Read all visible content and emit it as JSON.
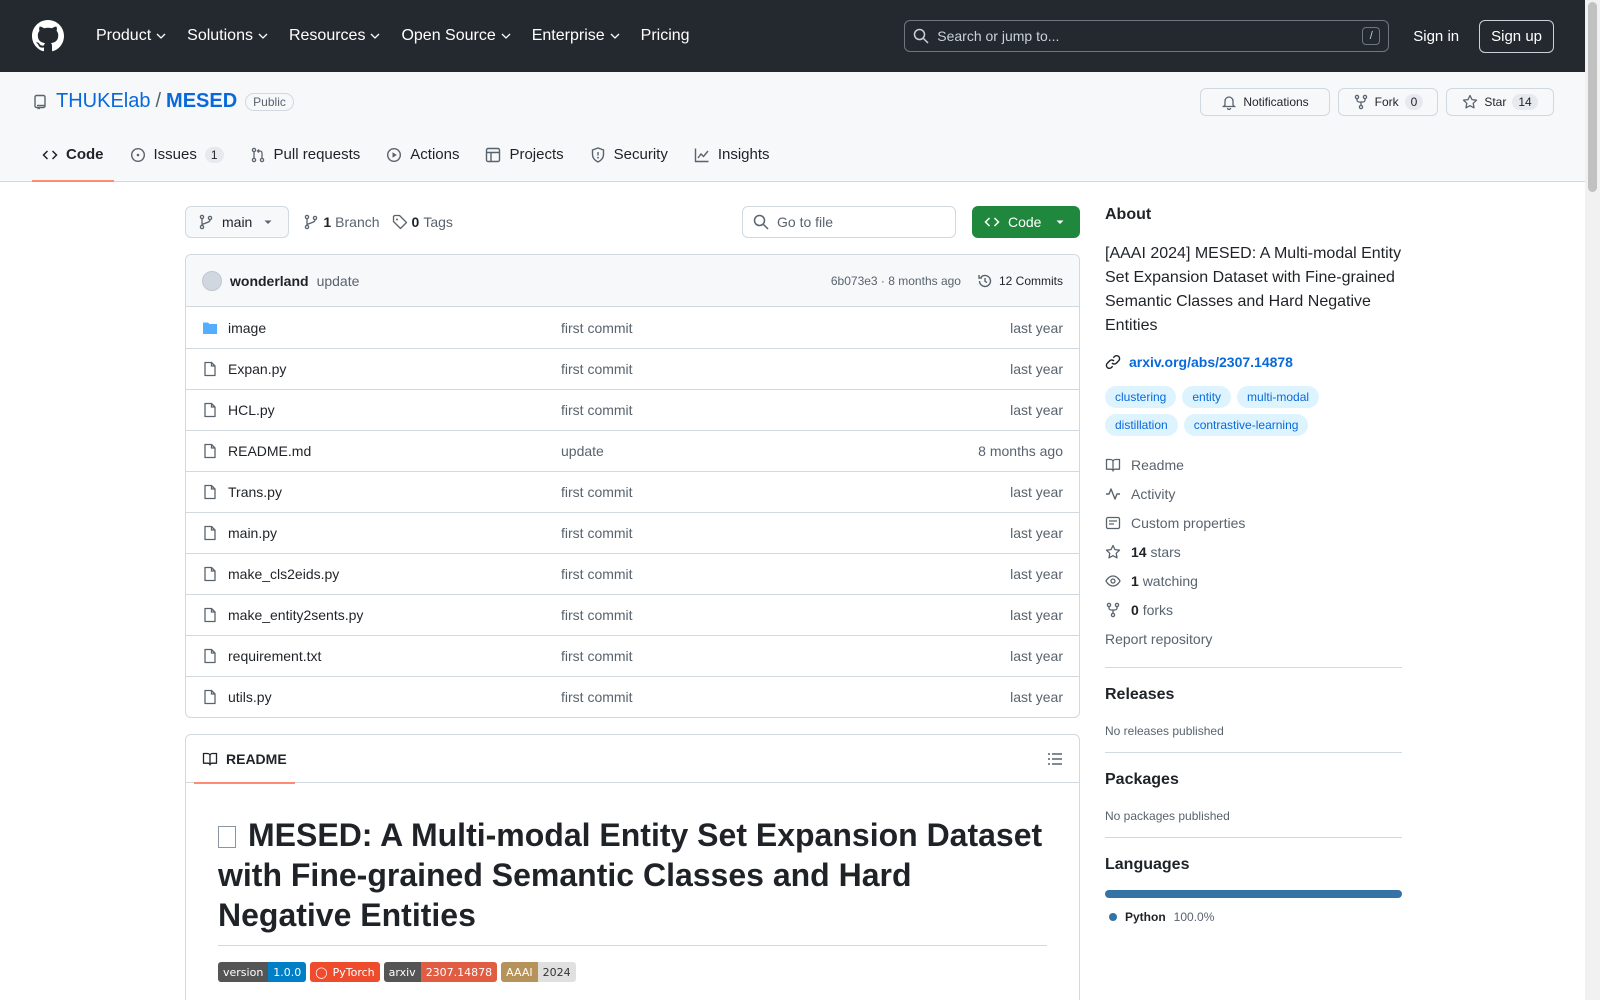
{
  "header": {
    "nav": [
      "Product",
      "Solutions",
      "Resources",
      "Open Source",
      "Enterprise",
      "Pricing"
    ],
    "search_placeholder": "Search or jump to...",
    "search_shortcut": "/",
    "signin": "Sign in",
    "signup": "Sign up"
  },
  "repo": {
    "owner": "THUKElab",
    "separator": "/",
    "name": "MESED",
    "visibility": "Public",
    "notifications_label": "Notifications",
    "fork_label": "Fork",
    "fork_count": "0",
    "star_label": "Star",
    "star_count": "14"
  },
  "tabs": [
    {
      "label": "Code",
      "count": ""
    },
    {
      "label": "Issues",
      "count": "1"
    },
    {
      "label": "Pull requests",
      "count": ""
    },
    {
      "label": "Actions",
      "count": ""
    },
    {
      "label": "Projects",
      "count": ""
    },
    {
      "label": "Security",
      "count": ""
    },
    {
      "label": "Insights",
      "count": ""
    }
  ],
  "toolbar": {
    "branch": "main",
    "branch_count": "1",
    "branch_label": "Branch",
    "tag_count": "0",
    "tag_label": "Tags",
    "goto_placeholder": "Go to file",
    "code_label": "Code"
  },
  "commit": {
    "author": "wonderland",
    "message": "update",
    "meta": "6b073e3 · 8 months ago",
    "commits_label": "12 Commits"
  },
  "files": [
    {
      "name": "image",
      "commit": "first commit",
      "date": "last year",
      "type": "dir"
    },
    {
      "name": "Expan.py",
      "commit": "first commit",
      "date": "last year",
      "type": "file"
    },
    {
      "name": "HCL.py",
      "commit": "first commit",
      "date": "last year",
      "type": "file"
    },
    {
      "name": "README.md",
      "commit": "update",
      "date": "8 months ago",
      "type": "file"
    },
    {
      "name": "Trans.py",
      "commit": "first commit",
      "date": "last year",
      "type": "file"
    },
    {
      "name": "main.py",
      "commit": "first commit",
      "date": "last year",
      "type": "file"
    },
    {
      "name": "make_cls2eids.py",
      "commit": "first commit",
      "date": "last year",
      "type": "file"
    },
    {
      "name": "make_entity2sents.py",
      "commit": "first commit",
      "date": "last year",
      "type": "file"
    },
    {
      "name": "requirement.txt",
      "commit": "first commit",
      "date": "last year",
      "type": "file"
    },
    {
      "name": "utils.py",
      "commit": "first commit",
      "date": "last year",
      "type": "file"
    }
  ],
  "readme": {
    "tab_label": "README",
    "title": "MESED: A Multi-modal Entity Set Expansion Dataset with Fine-grained Semantic Classes and Hard Negative Entities",
    "shields": [
      {
        "left": "version",
        "right": "1.0.0",
        "left_color": "#555555",
        "right_color": "#007ec6"
      },
      {
        "left": "",
        "right": "PyTorch",
        "left_color": "#ee4c2c",
        "right_color": "#ee4c2c"
      },
      {
        "left": "arxiv",
        "right": "2307.14878",
        "left_color": "#555555",
        "right_color": "#e05d44"
      },
      {
        "left": "AAAI",
        "right": "2024",
        "left_color": "#b5935a",
        "right_color": "#e0e0e0"
      }
    ]
  },
  "about": {
    "heading": "About",
    "description": "[AAAI 2024] MESED: A Multi-modal Entity Set Expansion Dataset with Fine-grained Semantic Classes and Hard Negative Entities",
    "link": "arxiv.org/abs/2307.14878",
    "topics": [
      "clustering",
      "entity",
      "multi-modal",
      "distillation",
      "contrastive-learning"
    ],
    "readme": "Readme",
    "activity": "Activity",
    "custom_properties": "Custom properties",
    "stars_count": "14",
    "stars_label": "stars",
    "watching_count": "1",
    "watching_label": "watching",
    "forks_count": "0",
    "forks_label": "forks",
    "report": "Report repository"
  },
  "releases": {
    "heading": "Releases",
    "text": "No releases published"
  },
  "packages": {
    "heading": "Packages",
    "text": "No packages published"
  },
  "languages": {
    "heading": "Languages",
    "name": "Python",
    "percent": "100.0%",
    "color": "#3572a5"
  }
}
